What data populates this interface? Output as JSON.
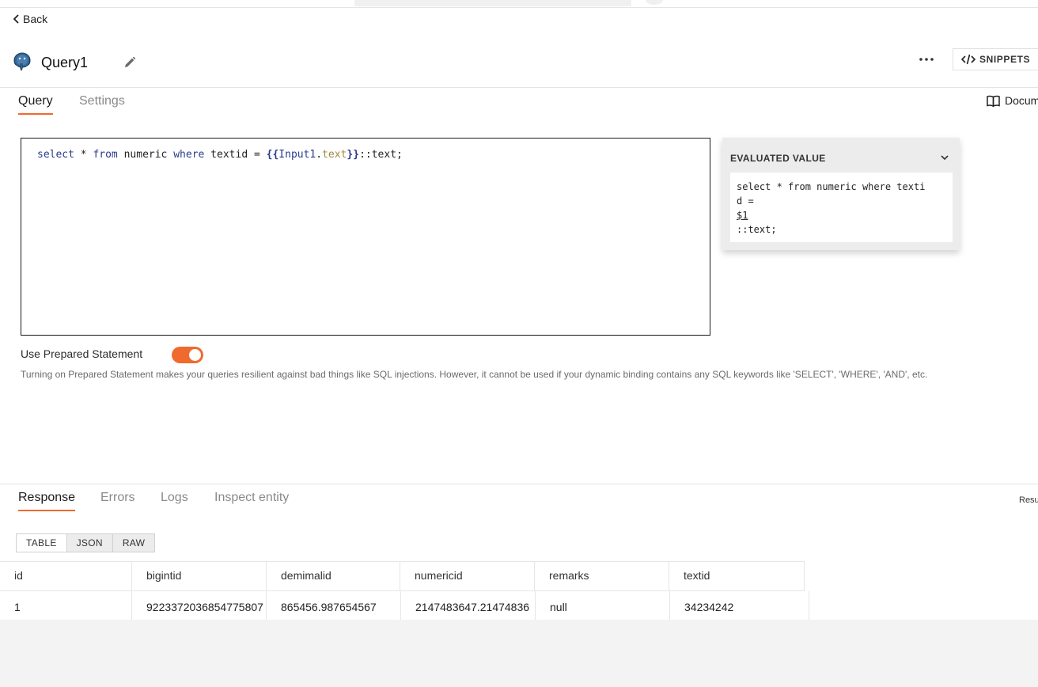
{
  "nav": {
    "back_label": "Back"
  },
  "header": {
    "title": "Query1",
    "snippets_label": "SNIPPETS"
  },
  "tabs": [
    {
      "label": "Query",
      "active": true
    },
    {
      "label": "Settings",
      "active": false
    }
  ],
  "doc_link_label": "Docum",
  "editor": {
    "code_parts": {
      "k1": "select",
      "p1": " * ",
      "k2": "from",
      "p2": " numeric ",
      "k3": "where",
      "p3": " textid = ",
      "open": "{{",
      "obj": "Input1",
      "dot": ".",
      "prop": "text",
      "close": "}}",
      "tail": "::text;"
    }
  },
  "evaluated": {
    "title": "EVALUATED VALUE",
    "lines": [
      "select * from numeric where texti",
      "d =",
      "$1",
      "::text;"
    ]
  },
  "prepared": {
    "label": "Use Prepared Statement",
    "enabled": true,
    "help": "Turning on Prepared Statement makes your queries resilient against bad things like SQL injections. However, it cannot be used if your dynamic binding contains any SQL keywords like 'SELECT', 'WHERE', 'AND', etc."
  },
  "response": {
    "tabs": [
      {
        "label": "Response",
        "active": true
      },
      {
        "label": "Errors",
        "active": false
      },
      {
        "label": "Logs",
        "active": false
      },
      {
        "label": "Inspect entity",
        "active": false
      }
    ],
    "result_note": "Resu",
    "views": [
      {
        "label": "TABLE",
        "active": true
      },
      {
        "label": "JSON",
        "active": false
      },
      {
        "label": "RAW",
        "active": false
      }
    ],
    "columns": [
      "id",
      "bigintid",
      "demimalid",
      "numericid",
      "remarks",
      "textid"
    ],
    "rows": [
      [
        "1",
        "9223372036854775807",
        "865456.987654567",
        "2147483647.21474836",
        "null",
        "34234242"
      ]
    ]
  },
  "colors": {
    "accent": "#f06a2e",
    "keyword": "#2a3b8f",
    "property": "#a08a3d"
  }
}
